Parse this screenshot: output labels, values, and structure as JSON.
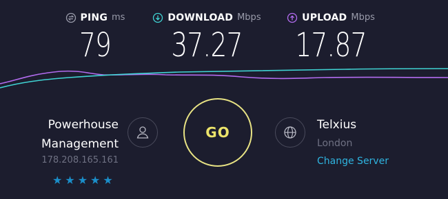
{
  "metrics": {
    "ping": {
      "label": "PING",
      "unit": "ms",
      "value": "79",
      "icon": "ping-icon"
    },
    "download": {
      "label": "DOWNLOAD",
      "unit": "Mbps",
      "value": "37.27",
      "icon": "download-arrow-icon"
    },
    "upload": {
      "label": "UPLOAD",
      "unit": "Mbps",
      "value": "17.87",
      "icon": "upload-arrow-icon"
    }
  },
  "isp": {
    "name_line1": "Powerhouse",
    "name_line2": "Management",
    "ip": "178.208.165.161",
    "rating": "★★★★★"
  },
  "go_button": {
    "label": "GO"
  },
  "server": {
    "name": "Telxius",
    "location": "London",
    "change_label": "Change Server"
  },
  "colors": {
    "background": "#1c1d2e",
    "ping_icon": "#9a9cab",
    "download_accent": "#40d4d4",
    "upload_accent": "#b36cf0",
    "go_ring": "#e8e384",
    "link": "#2fb4e0",
    "stars": "#1b8ec9"
  }
}
